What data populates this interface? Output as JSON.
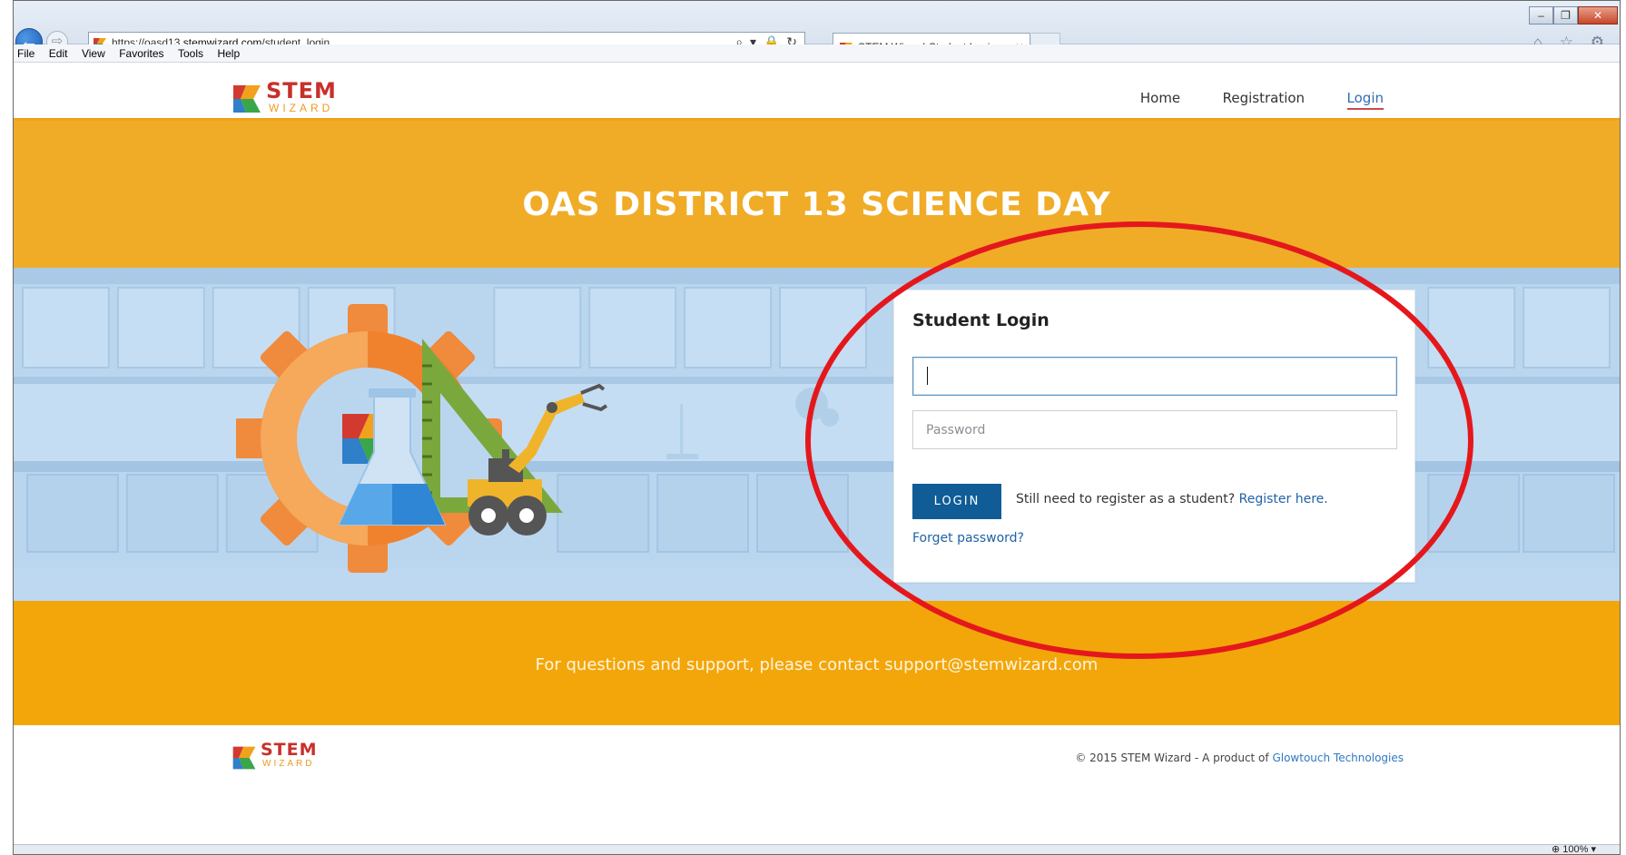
{
  "browser": {
    "url_prefix": "https://",
    "url_subdomain": "oasd13.",
    "url_domain": "stemwizard.com",
    "url_path": "/student_login",
    "address_tools": "⌕ ▾ 🔒 ↻",
    "tab_title": "STEM Wizard-Student Login",
    "tab_close": "×",
    "back_glyph": "←",
    "forward_glyph": "⇨",
    "minimize_glyph": "–",
    "restore_glyph": "❐",
    "close_glyph": "✕",
    "right_icons": "⌂ ☆ ⚙",
    "menu": [
      "File",
      "Edit",
      "View",
      "Favorites",
      "Tools",
      "Help"
    ],
    "zoom": "⊕ 100%  ▾"
  },
  "logo": {
    "stem": "STEM",
    "wizard": "WIZARD"
  },
  "nav": {
    "home": "Home",
    "registration": "Registration",
    "login": "Login"
  },
  "banner": {
    "title": "OAS DISTRICT 13 SCIENCE DAY"
  },
  "login": {
    "heading": "Student Login",
    "username_value": "",
    "password_placeholder": "Password",
    "button": "LOGIN",
    "register_prompt": "Still need to register as a student?",
    "register_link": "Register here.",
    "forgot": "Forget password?"
  },
  "support": {
    "text": "For questions and support, please contact support@stemwizard.com"
  },
  "footer": {
    "copyright_text": "© 2015 STEM Wizard - A product of",
    "company_link": "Glowtouch Technologies"
  },
  "colors": {
    "banner": "#f0ac27",
    "support_band": "#f3a60a",
    "login_button": "#0f5c96",
    "link": "#1f62a7",
    "annotation": "#e4181c"
  }
}
